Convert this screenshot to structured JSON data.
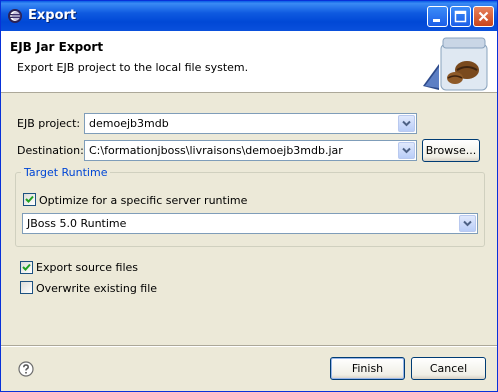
{
  "window": {
    "title": "Export"
  },
  "banner": {
    "title": "EJB Jar Export",
    "description": "Export EJB project to the local file system."
  },
  "form": {
    "ejb_project_label": "EJB project:",
    "ejb_project_value": "demoejb3mdb",
    "destination_label": "Destination:",
    "destination_value": "C:\\formationjboss\\livraisons\\demoejb3mdb.jar",
    "browse_label": "Browse..."
  },
  "target_runtime": {
    "group_title": "Target Runtime",
    "optimize_label": "Optimize for a specific server runtime",
    "optimize_checked": true,
    "runtime_value": "JBoss 5.0 Runtime"
  },
  "options": {
    "export_source_label": "Export source files",
    "export_source_checked": true,
    "overwrite_label": "Overwrite existing file",
    "overwrite_checked": false
  },
  "buttons": {
    "finish": "Finish",
    "cancel": "Cancel"
  },
  "icons": {
    "title": "eclipse-icon",
    "banner": "ejb-bean-jar-icon",
    "help": "help-icon",
    "minimize": "minimize-icon",
    "maximize": "maximize-icon",
    "close": "close-icon"
  },
  "colors": {
    "titlebar": "#0054e3",
    "group_title": "#0046d5",
    "dialog_bg": "#ece9d8"
  }
}
